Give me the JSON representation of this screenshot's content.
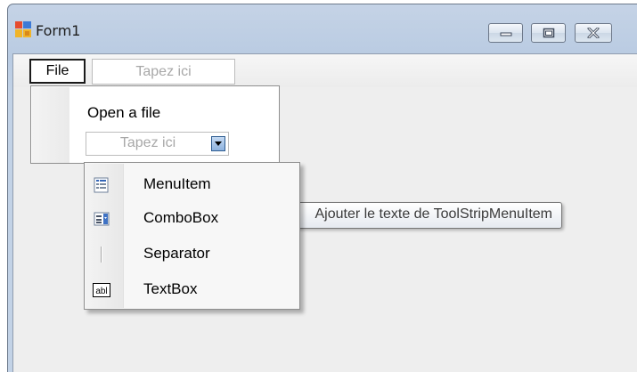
{
  "window": {
    "title": "Form1",
    "icon": "form-app-icon",
    "caption_buttons": [
      "minimize-icon",
      "maximize-icon",
      "close-icon"
    ]
  },
  "menubar": {
    "items": [
      {
        "label": "File",
        "state": "selected"
      },
      {
        "label": "Tapez ici",
        "state": "placeholder"
      }
    ]
  },
  "dropdown": {
    "items": [
      {
        "label": "Open a file"
      },
      {
        "label": "Tapez ici",
        "type": "type-here-combo"
      }
    ]
  },
  "add_item_popup": {
    "items": [
      {
        "label": "MenuItem",
        "icon": "menuitem-icon"
      },
      {
        "label": "ComboBox",
        "icon": "combobox-icon"
      },
      {
        "label": "Separator",
        "icon": "separator-icon"
      },
      {
        "label": "TextBox",
        "icon": "textbox-icon",
        "icon_text": "abl"
      }
    ]
  },
  "tooltip": {
    "text": "Ajouter le texte de ToolStripMenuItem"
  },
  "colors": {
    "title_bar": "#b9cbe2",
    "client_area": "#eeeeee",
    "selection_blue": "#8eb2de"
  }
}
